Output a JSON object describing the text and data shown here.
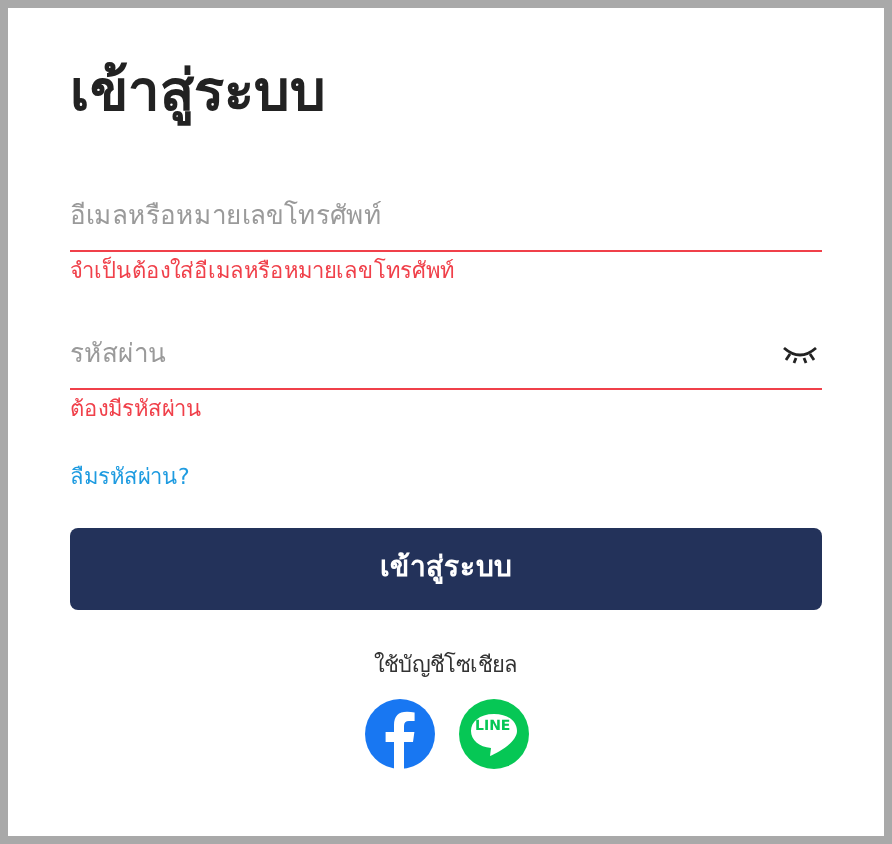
{
  "title": "เข้าสู่ระบบ",
  "fields": [
    {
      "kind": "text",
      "placeholder": "อีเมลหรือหมายเลขโทรศัพท์",
      "invalid": true,
      "error": "จำเป็นต้องใส่อีเมลหรือหมายเลขโทรศัพท์"
    },
    {
      "kind": "password",
      "placeholder": "รหัสผ่าน",
      "invalid": true,
      "error": "ต้องมีรหัสผ่าน"
    }
  ],
  "forgot_link": "ลืมรหัสผ่าน?",
  "submit_button": "เข้าสู่ระบบ",
  "social": {
    "label": "ใช้บัญชีโซเชียล",
    "buttons": [
      {
        "kind": "facebook"
      },
      {
        "kind": "line",
        "text": "LINE"
      }
    ]
  }
}
